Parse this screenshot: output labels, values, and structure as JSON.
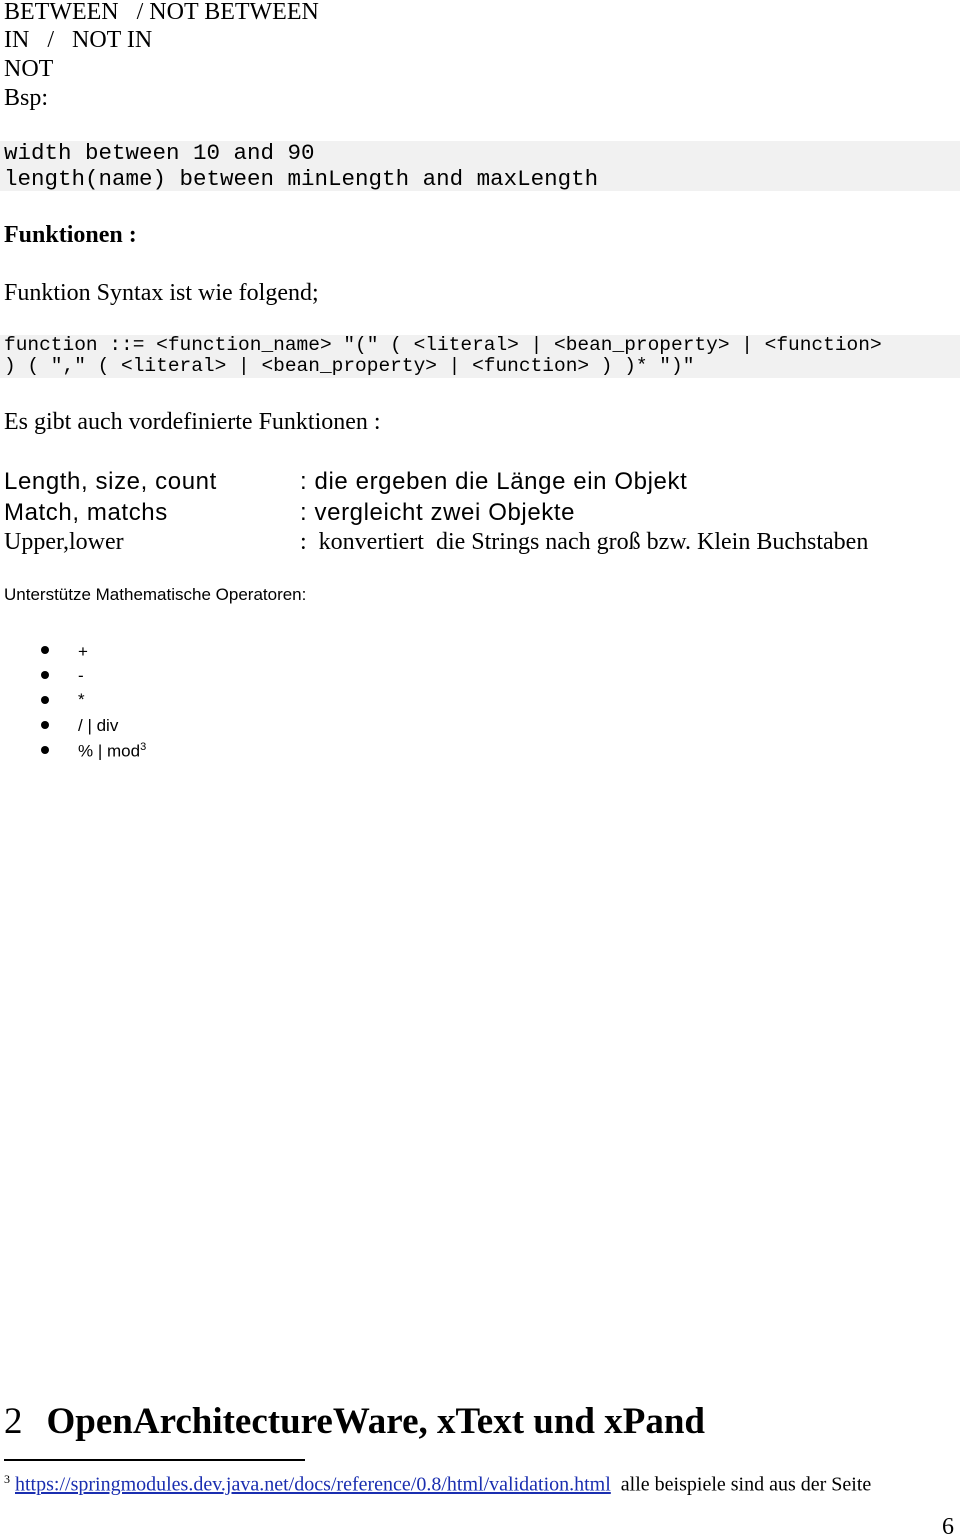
{
  "operators_top": [
    "BETWEEN   / NOT BETWEEN",
    "IN   /   NOT IN",
    "NOT",
    "Bsp:"
  ],
  "example_code": [
    "width between 10 and 90",
    "length(name) between minLength and maxLength"
  ],
  "functions_heading": "Funktionen :",
  "syntax_intro": "Funktion Syntax ist wie folgend;",
  "syntax_code": [
    "function ::= <function_name> \"(\" ( <literal> | <bean_property> | <function>",
    ") ( \",\" ( <literal> | <bean_property> | <function> ) )* \")\""
  ],
  "predefined_intro": "Es gibt auch vordefinierte Funktionen :",
  "predefined": [
    {
      "name": "Length, size, count",
      "desc": ": die ergeben die Länge ein Objekt"
    },
    {
      "name": "Match, matchs",
      "desc": ": vergleicht zwei Objekte"
    },
    {
      "name": "Upper,lower",
      "desc": ":  konvertiert  die Strings nach groß bzw. Klein Buchstaben"
    }
  ],
  "math_heading": "Unterstütze Mathematische Operatoren:",
  "math_ops": [
    "+",
    "-",
    "*",
    "/ | div",
    "% | mod"
  ],
  "math_footnote_ref": "3",
  "section_number": "2",
  "section_title": "OpenArchitectureWare, xText und xPand",
  "footnote": {
    "marker": "3",
    "url": "https://springmodules.dev.java.net/docs/reference/0.8/html/validation.html",
    "text": "alle beispiele sind aus der Seite"
  },
  "page_number": "6"
}
